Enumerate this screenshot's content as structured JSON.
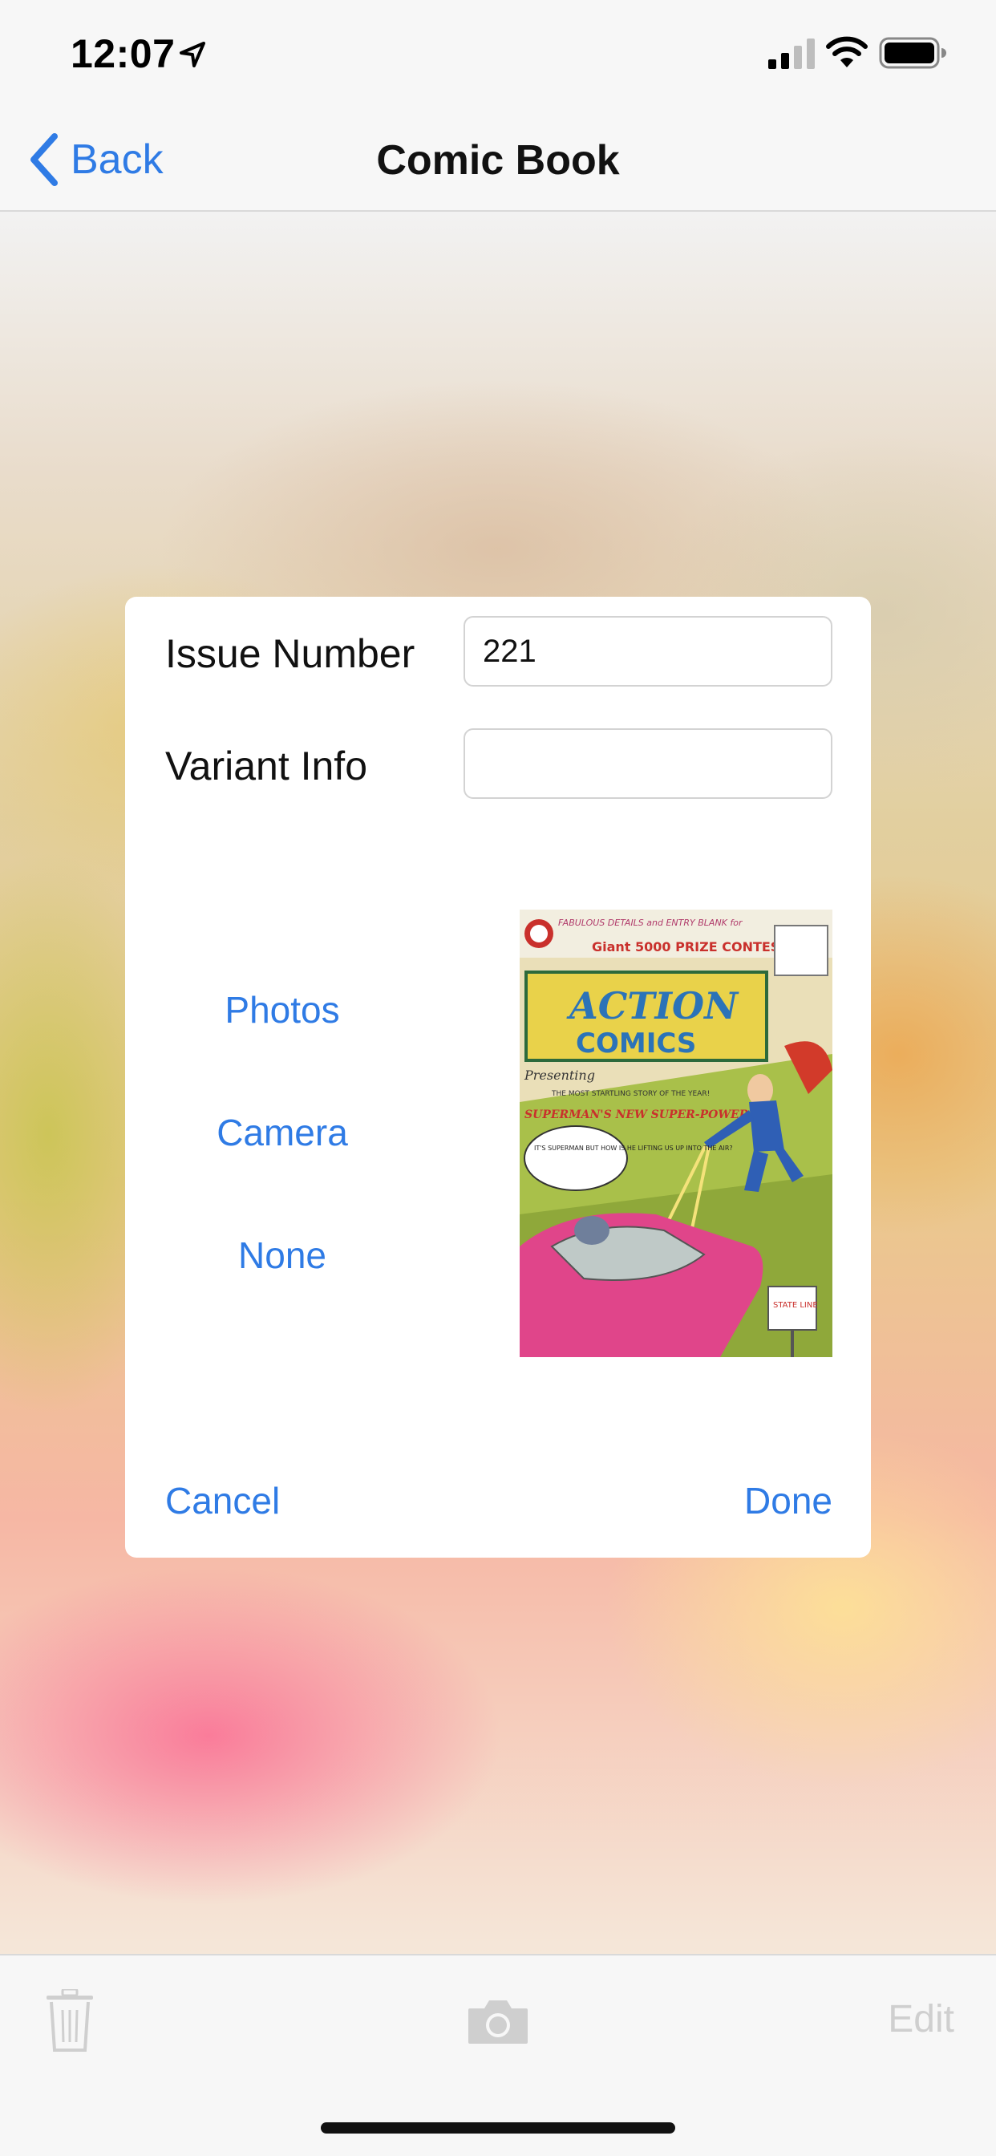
{
  "status_bar": {
    "time": "12:07"
  },
  "nav": {
    "back_label": "Back",
    "title": "Comic Book"
  },
  "form": {
    "issue_number_label": "Issue Number",
    "issue_number_value": "221",
    "variant_info_label": "Variant Info",
    "variant_info_value": ""
  },
  "image_sources": [
    "Photos",
    "Camera",
    "None"
  ],
  "cover": {
    "teaser_line": "FABULOUS DETAILS and ENTRY BLANK for",
    "contest": "Giant 5000 PRIZE CONTEST!",
    "title_line_1": "ACTION",
    "title_line_2": "COMICS",
    "presenting": "Presenting",
    "story_intro": "THE MOST STARTLING STORY OF THE YEAR!",
    "story_title": "SUPERMAN'S NEW SUPER-POWER!",
    "speech": "IT'S SUPERMAN BUT HOW IS HE LIFTING US UP INTO THE AIR?",
    "sign": "STATE LINE"
  },
  "modal_footer": {
    "cancel_label": "Cancel",
    "done_label": "Done"
  },
  "toolbar": {
    "edit_label": "Edit"
  },
  "colors": {
    "accent": "#2f7be5",
    "disabled": "#cfcfcf"
  }
}
